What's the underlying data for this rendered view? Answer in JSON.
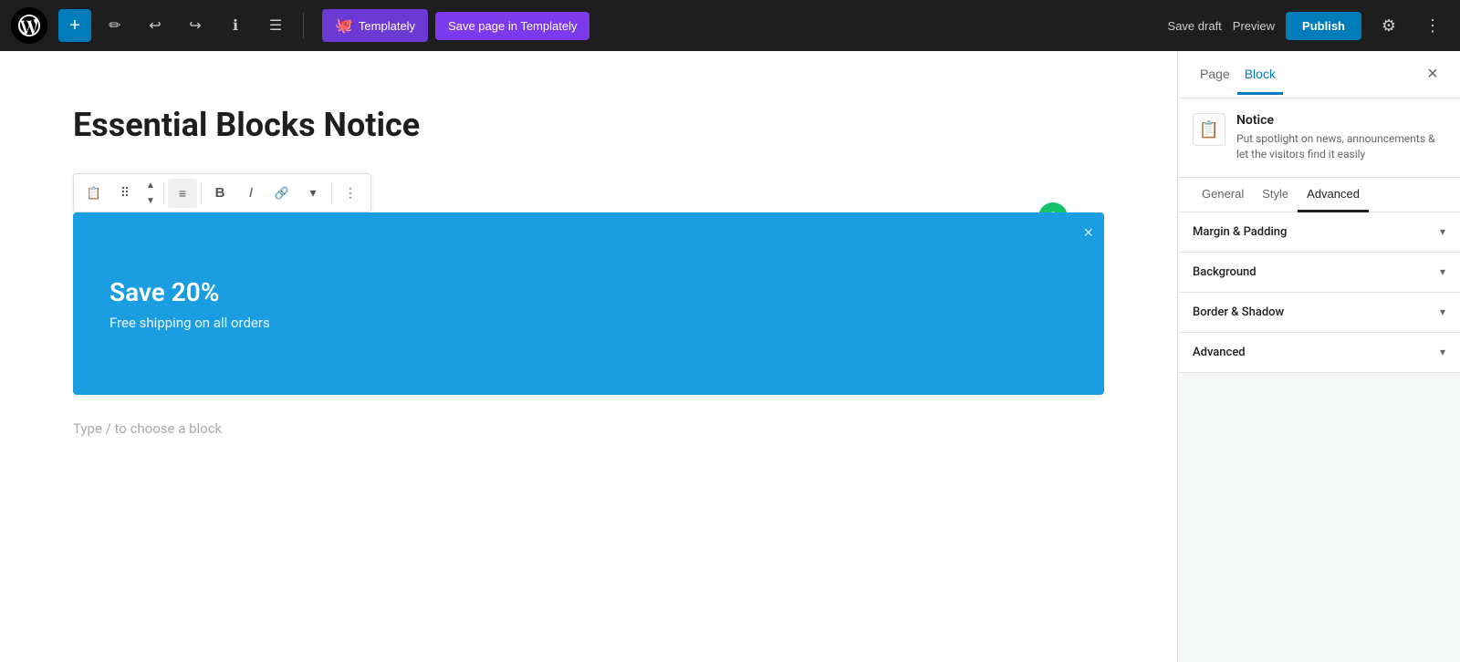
{
  "topbar": {
    "add_label": "+",
    "edit_icon": "✏",
    "undo_icon": "↩",
    "redo_icon": "↪",
    "info_icon": "ℹ",
    "list_icon": "☰",
    "templately_label": "Templately",
    "save_templately_label": "Save page in Templately",
    "save_draft_label": "Save draft",
    "preview_label": "Preview",
    "publish_label": "Publish",
    "settings_icon": "⚙",
    "more_icon": "⋮"
  },
  "editor": {
    "page_title": "Essential Blocks Notice",
    "type_hint": "Type / to choose a block",
    "notice": {
      "heading": "Save 20%",
      "subtext": "Free shipping on all orders",
      "close_icon": "×",
      "bg_color": "#1b9de2"
    },
    "grammarly_label": "G"
  },
  "sidebar": {
    "page_tab": "Page",
    "block_tab": "Block",
    "close_icon": "×",
    "block_info": {
      "icon_symbol": "📋",
      "name": "Notice",
      "description": "Put spotlight on news, announcements & let the visitors find it easily"
    },
    "block_tabs": [
      {
        "label": "General"
      },
      {
        "label": "Style"
      },
      {
        "label": "Advanced"
      }
    ],
    "active_block_tab": "Advanced",
    "accordion_sections": [
      {
        "title": "Margin & Padding",
        "expanded": false
      },
      {
        "title": "Background",
        "expanded": false
      },
      {
        "title": "Border & Shadow",
        "expanded": false
      },
      {
        "title": "Advanced",
        "expanded": false
      }
    ]
  }
}
